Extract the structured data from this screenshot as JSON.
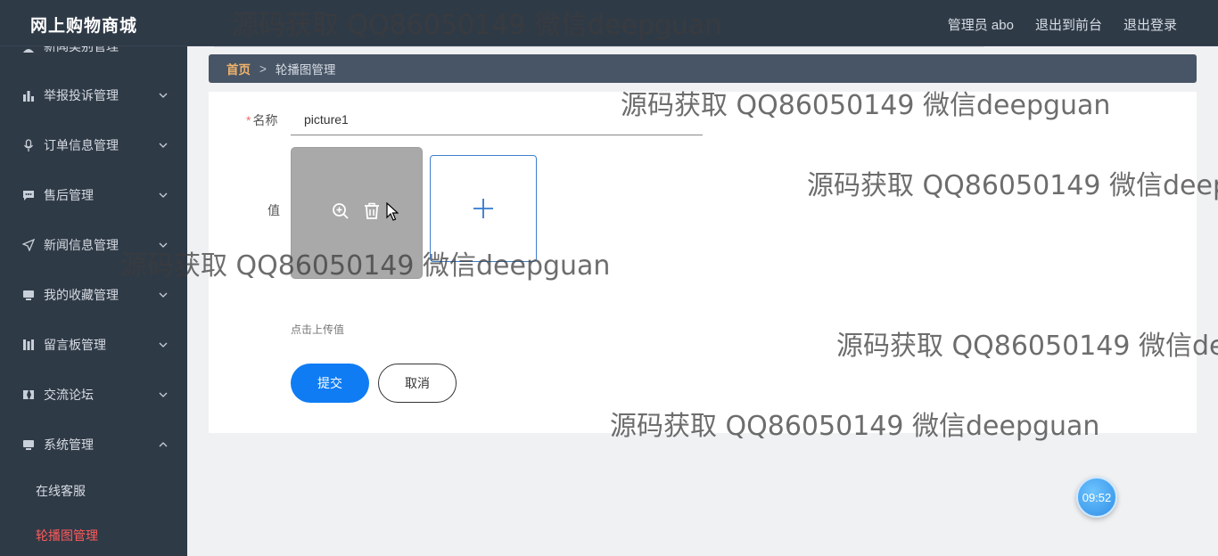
{
  "header": {
    "app_title": "网上购物商城",
    "links": [
      "管理员 abo",
      "退出到前台",
      "退出登录"
    ]
  },
  "sidebar": {
    "items": [
      {
        "label": "新闻类别管理",
        "icon": "user-icon"
      },
      {
        "label": "举报投诉管理",
        "icon": "bar-chart-icon"
      },
      {
        "label": "订单信息管理",
        "icon": "microphone-icon"
      },
      {
        "label": "售后管理",
        "icon": "chat-icon"
      },
      {
        "label": "新闻信息管理",
        "icon": "send-icon"
      },
      {
        "label": "我的收藏管理",
        "icon": "monitor-icon"
      },
      {
        "label": "留言板管理",
        "icon": "columns-icon"
      },
      {
        "label": "交流论坛",
        "icon": "forum-icon"
      },
      {
        "label": "系统管理",
        "icon": "monitor-icon"
      }
    ],
    "sub_items": [
      "在线客服",
      "轮播图管理"
    ],
    "active_sub": "轮播图管理"
  },
  "breadcrumb": {
    "home": "首页",
    "separator": ">",
    "current": "轮播图管理"
  },
  "form": {
    "name_label": "名称",
    "name_value": "picture1",
    "value_label": "值",
    "upload_hint": "点击上传值",
    "submit_label": "提交",
    "cancel_label": "取消"
  },
  "clock": "09:52",
  "watermark": "源码获取 QQ86050149 微信deepguan",
  "colors": {
    "sidebar_bg": "#2f3a47",
    "breadcrumb_bg": "#485566",
    "accent": "#0f7cf3",
    "active_menu": "#ff5a5a",
    "breadcrumb_home": "#f0b36a"
  }
}
